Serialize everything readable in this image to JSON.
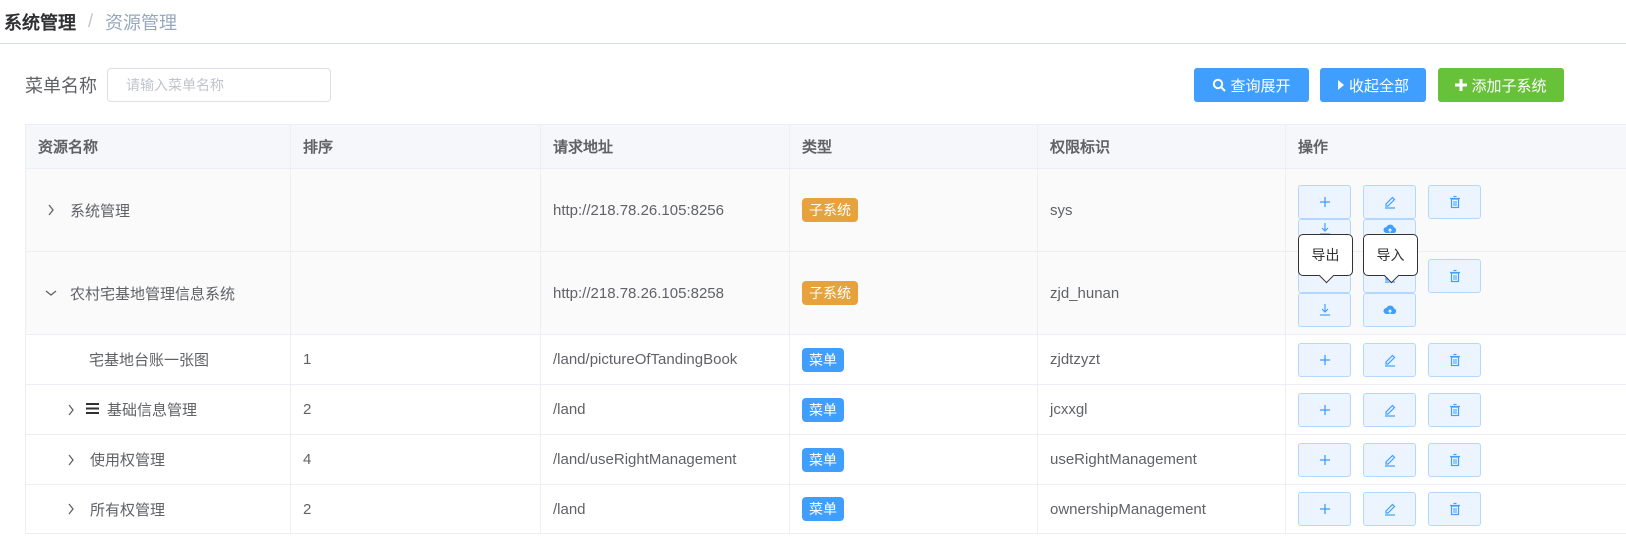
{
  "breadcrumb": {
    "root": "系统管理",
    "separator": "/",
    "current": "资源管理"
  },
  "search": {
    "label": "菜单名称",
    "placeholder": "请输入菜单名称",
    "value": ""
  },
  "buttons": {
    "query_expand": "查询展开",
    "collapse_all": "收起全部",
    "add_subsystem": "添加子系统"
  },
  "table": {
    "headers": [
      "资源名称",
      "排序",
      "请求地址",
      "类型",
      "权限标识",
      "操作"
    ],
    "rows": [
      {
        "name": "系统管理",
        "order": "",
        "url": "http://218.78.26.105:8256",
        "type": "子系统",
        "perm": "sys"
      },
      {
        "name": "农村宅基地管理信息系统",
        "order": "",
        "url": "http://218.78.26.105:8258",
        "type": "子系统",
        "perm": "zjd_hunan"
      },
      {
        "name": "宅基地台账一张图",
        "order": "1",
        "url": "/land/pictureOfTandingBook",
        "type": "菜单",
        "perm": "zjdtzyzt"
      },
      {
        "name": "基础信息管理",
        "order": "2",
        "url": "/land",
        "type": "菜单",
        "perm": "jcxxgl"
      },
      {
        "name": "使用权管理",
        "order": "4",
        "url": "/land/useRightManagement",
        "type": "菜单",
        "perm": "useRightManagement"
      },
      {
        "name": "所有权管理",
        "order": "2",
        "url": "/land",
        "type": "菜单",
        "perm": "ownershipManagement"
      }
    ]
  },
  "tooltips": {
    "export": "导出",
    "import": "导入"
  },
  "colors": {
    "primary": "#409eff",
    "success": "#67c23a",
    "warning": "#e6a23c"
  }
}
